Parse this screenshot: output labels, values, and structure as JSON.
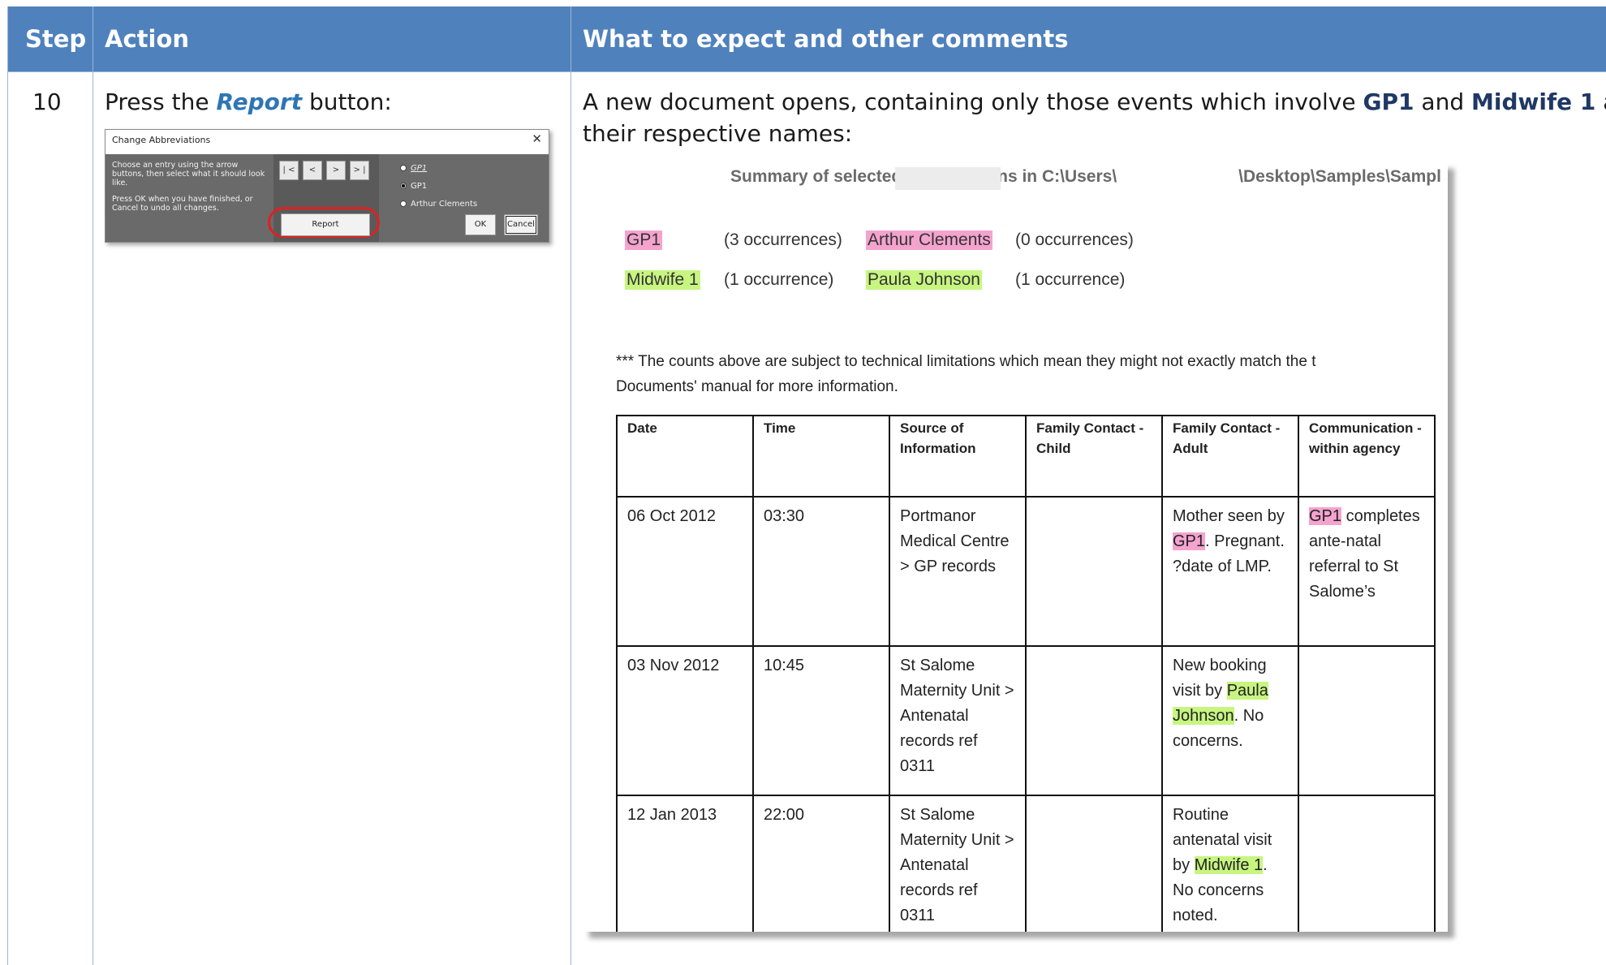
{
  "header": {
    "step": "Step",
    "action": "Action",
    "comments": "What to expect and other comments"
  },
  "row": {
    "step_number": "10",
    "action_prefix": "Press the ",
    "action_emphasis": "Report",
    "action_suffix": " button:",
    "comment_part1": "A new document opens, containing only those events which involve ",
    "comment_bold1": "GP1",
    "comment_part2": " and ",
    "comment_bold2": "Midwife 1",
    "comment_part3": " and",
    "comment_line2": "their respective names:"
  },
  "dialog": {
    "title": "Change Abbreviations",
    "close": "✕",
    "help1": "Choose an entry using the arrow buttons, then select what it should look like.",
    "help2": "Press OK when you have finished, or Cancel to undo all changes.",
    "nav": [
      "| <",
      "<",
      ">",
      "> |"
    ],
    "options": [
      "GP1",
      "GP1",
      "Arthur Clements"
    ],
    "report_button": "Report",
    "ok_button": "OK",
    "cancel_button": "Cancel"
  },
  "report": {
    "title_left": "Summary of selected abbreviations in C:\\Users\\",
    "title_right": "\\Desktop\\Samples\\Sampl",
    "abbreviations": [
      {
        "abbr": "GP1",
        "abbr_count": "(3 occurrences)",
        "name": "Arthur Clements",
        "name_count": "(0 occurrences)"
      },
      {
        "abbr": "Midwife 1",
        "abbr_count": "(1 occurrence)",
        "name": "Paula Johnson",
        "name_count": "(1 occurrence)"
      }
    ],
    "note_line1": "*** The counts above are subject to technical limitations which mean they might not exactly match the t",
    "note_line2": "Documents' manual for more information.",
    "columns": [
      "Date",
      "Time",
      "Source of Information",
      "Family Contact - Child",
      "Family Contact - Adult",
      "Communication - within agency"
    ],
    "rows": [
      {
        "date": "06 Oct 2012",
        "time": "03:30",
        "source": "Portmanor Medical Centre > GP records",
        "child": "",
        "adult_a": "Mother seen by ",
        "adult_hl": "GP1",
        "adult_b": ". Pregnant. ?date of LMP.",
        "comm_hl": "GP1",
        "comm_b": " completes ante-natal referral to St Salome’s"
      },
      {
        "date": "03 Nov 2012",
        "time": "10:45",
        "source": "St Salome Maternity Unit > Antenatal records ref 0311",
        "child": "",
        "adult_a": "New booking visit by ",
        "adult_hl": "Paula Johnson",
        "adult_b": ". No concerns.",
        "comm_hl": "",
        "comm_b": ""
      },
      {
        "date": "12 Jan 2013",
        "time": "22:00",
        "source": "St Salome Maternity Unit > Antenatal records ref 0311",
        "child": "",
        "adult_a": "Routine antenatal visit by ",
        "adult_hl": "Midwife 1",
        "adult_b": ". No concerns noted.",
        "comm_hl": "",
        "comm_b": ""
      }
    ]
  }
}
